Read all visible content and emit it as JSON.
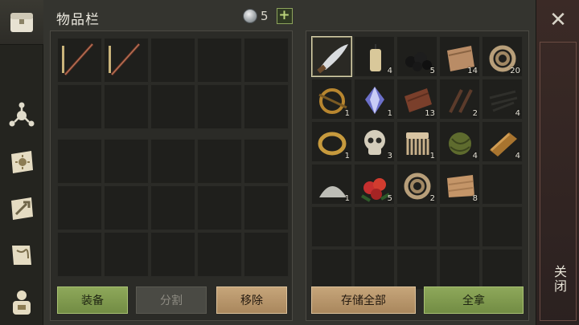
{
  "window": {
    "title": "物品栏"
  },
  "currency": {
    "amount": "5",
    "add_label": "+"
  },
  "rail": {
    "items": [
      {
        "name": "chest-icon"
      },
      {
        "name": "skills-icon"
      },
      {
        "name": "journal-icon"
      },
      {
        "name": "crafting-icon"
      },
      {
        "name": "map-scroll-icon"
      },
      {
        "name": "backpack-icon"
      }
    ]
  },
  "left_slots": [
    {
      "item": "spear"
    },
    {
      "item": "spear"
    },
    {},
    {},
    {},
    {},
    {},
    {},
    {},
    {},
    {},
    {},
    {},
    {},
    {},
    {},
    {},
    {},
    {},
    {},
    {},
    {},
    {},
    {},
    {}
  ],
  "right_slots": [
    {
      "item": "machete",
      "qty": ""
    },
    {
      "item": "candle",
      "qty": "4"
    },
    {
      "item": "coal",
      "qty": "5"
    },
    {
      "item": "leather",
      "qty": "14"
    },
    {
      "item": "rope",
      "qty": "20"
    },
    {
      "item": "bronze-ring-pin",
      "qty": "1"
    },
    {
      "item": "crystal",
      "qty": "1"
    },
    {
      "item": "wood-plank",
      "qty": "13"
    },
    {
      "item": "nails",
      "qty": "2"
    },
    {
      "item": "wire",
      "qty": "4"
    },
    {
      "item": "gold-ring",
      "qty": "1"
    },
    {
      "item": "skull",
      "qty": "3"
    },
    {
      "item": "comb",
      "qty": "1"
    },
    {
      "item": "green-ball",
      "qty": "4"
    },
    {
      "item": "ingot",
      "qty": "4"
    },
    {
      "item": "powder",
      "qty": "1"
    },
    {
      "item": "berries",
      "qty": "5"
    },
    {
      "item": "rope",
      "qty": "2"
    },
    {
      "item": "cloth",
      "qty": "8"
    },
    {
      "item": "",
      "qty": ""
    }
  ],
  "buttons": {
    "equip": "装备",
    "split": "分割",
    "remove": "移除",
    "store_all": "存储全部",
    "take_all": "全拿"
  },
  "close": {
    "icon": "close-icon",
    "label": "关闭"
  },
  "colors": {
    "accent_green": "#8ea85a",
    "accent_tan": "#c6a57a",
    "panel_bg": "#34342f"
  }
}
